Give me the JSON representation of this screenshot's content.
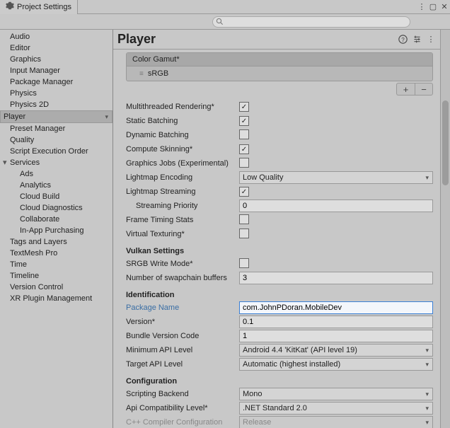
{
  "window": {
    "title": "Project Settings"
  },
  "search": {
    "placeholder": ""
  },
  "sidebar": {
    "items": [
      {
        "label": "Audio"
      },
      {
        "label": "Editor"
      },
      {
        "label": "Graphics"
      },
      {
        "label": "Input Manager"
      },
      {
        "label": "Package Manager"
      },
      {
        "label": "Physics"
      },
      {
        "label": "Physics 2D"
      },
      {
        "label": "Player",
        "selected": true
      },
      {
        "label": "Preset Manager"
      },
      {
        "label": "Quality"
      },
      {
        "label": "Script Execution Order"
      },
      {
        "label": "Services",
        "expanded": true,
        "children": [
          {
            "label": "Ads"
          },
          {
            "label": "Analytics"
          },
          {
            "label": "Cloud Build"
          },
          {
            "label": "Cloud Diagnostics"
          },
          {
            "label": "Collaborate"
          },
          {
            "label": "In-App Purchasing"
          }
        ]
      },
      {
        "label": "Tags and Layers"
      },
      {
        "label": "TextMesh Pro"
      },
      {
        "label": "Time"
      },
      {
        "label": "Timeline"
      },
      {
        "label": "Version Control"
      },
      {
        "label": "XR Plugin Management"
      }
    ]
  },
  "header": {
    "title": "Player"
  },
  "gamut": {
    "header": "Color Gamut*",
    "item": "sRGB"
  },
  "rendering": {
    "multithreaded": {
      "label": "Multithreaded Rendering*",
      "checked": true
    },
    "static_batching": {
      "label": "Static Batching",
      "checked": true
    },
    "dynamic_batching": {
      "label": "Dynamic Batching",
      "checked": false
    },
    "compute_skinning": {
      "label": "Compute Skinning*",
      "checked": true
    },
    "graphics_jobs": {
      "label": "Graphics Jobs (Experimental)",
      "checked": false
    },
    "lightmap_encoding": {
      "label": "Lightmap Encoding",
      "value": "Low Quality"
    },
    "lightmap_streaming": {
      "label": "Lightmap Streaming",
      "checked": true
    },
    "streaming_priority": {
      "label": "Streaming Priority",
      "value": "0"
    },
    "frame_timing": {
      "label": "Frame Timing Stats",
      "checked": false
    },
    "virtual_texturing": {
      "label": "Virtual Texturing*",
      "checked": false
    }
  },
  "vulkan": {
    "heading": "Vulkan Settings",
    "srgb_write": {
      "label": "SRGB Write Mode*",
      "checked": false
    },
    "swapchain": {
      "label": "Number of swapchain buffers",
      "value": "3"
    }
  },
  "identification": {
    "heading": "Identification",
    "package_name": {
      "label": "Package Name",
      "value": "com.JohnPDoran.MobileDev"
    },
    "version": {
      "label": "Version*",
      "value": "0.1"
    },
    "bundle_code": {
      "label": "Bundle Version Code",
      "value": "1"
    },
    "min_api": {
      "label": "Minimum API Level",
      "value": "Android 4.4 'KitKat' (API level 19)"
    },
    "target_api": {
      "label": "Target API Level",
      "value": "Automatic (highest installed)"
    }
  },
  "configuration": {
    "heading": "Configuration",
    "scripting_backend": {
      "label": "Scripting Backend",
      "value": "Mono"
    },
    "api_compat": {
      "label": "Api Compatibility Level*",
      "value": ".NET Standard 2.0"
    },
    "cpp_compiler": {
      "label": "C++ Compiler Configuration",
      "value": "Release"
    }
  }
}
